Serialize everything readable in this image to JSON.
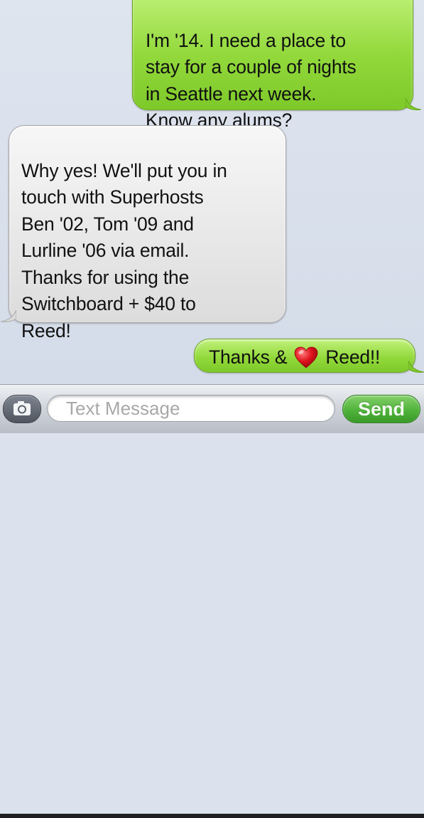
{
  "messages": [
    {
      "direction": "sent",
      "text": "I'm '14. I need a place to\nstay for a  couple of nights\nin Seattle next week.\nKnow any alums?"
    },
    {
      "direction": "received",
      "text": "Why yes! We'll put you in\ntouch with Superhosts\nBen '02, Tom '09 and\nLurline '06 via email.\nThanks for using the\nSwitchboard + $40 to\nReed!"
    },
    {
      "direction": "sent",
      "text_before": "Thanks &",
      "icon": "red-heart-icon",
      "text_after": "Reed!!"
    }
  ],
  "composer": {
    "camera_icon": "camera-icon",
    "placeholder": "Text Message",
    "value": "",
    "send_label": "Send"
  },
  "colors": {
    "sent_bubble": "#93d93c",
    "received_bubble": "#e7e7e7",
    "send_button": "#4fb33a",
    "heart": "#e0141e"
  }
}
